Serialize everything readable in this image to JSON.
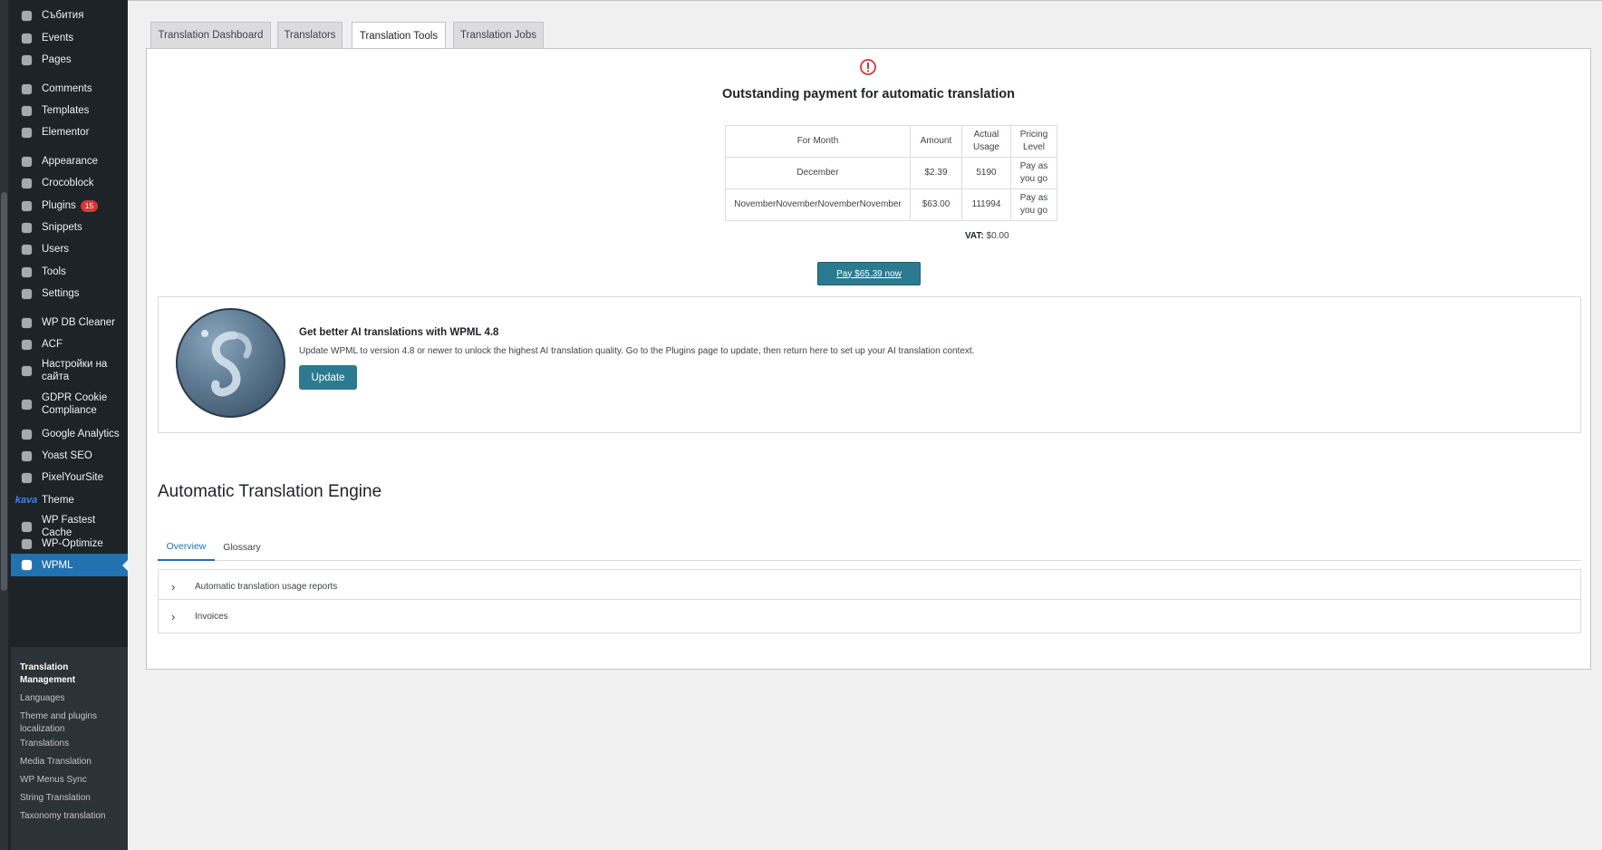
{
  "sidebar": {
    "items": [
      {
        "label": "Събития",
        "icon": "calendar-icon"
      },
      {
        "label": "Events",
        "icon": "events-icon"
      },
      {
        "label": "Pages",
        "icon": "pages-icon"
      },
      {
        "label": "Comments",
        "icon": "comments-icon"
      },
      {
        "label": "Templates",
        "icon": "folder-icon"
      },
      {
        "label": "Elementor",
        "icon": "elementor-icon"
      },
      {
        "label": "Appearance",
        "icon": "brush-icon"
      },
      {
        "label": "Crocoblock",
        "icon": "crocoblock-icon"
      },
      {
        "label": "Plugins",
        "icon": "plugin-icon",
        "badge": "15"
      },
      {
        "label": "Snippets",
        "icon": "scissors-icon"
      },
      {
        "label": "Users",
        "icon": "user-icon"
      },
      {
        "label": "Tools",
        "icon": "wrench-icon"
      },
      {
        "label": "Settings",
        "icon": "settings-icon"
      },
      {
        "label": "WP DB Cleaner",
        "icon": "database-icon"
      },
      {
        "label": "ACF",
        "icon": "acf-icon"
      },
      {
        "label": "Настройки на сайта",
        "icon": "gear-icon"
      },
      {
        "label": "GDPR Cookie Compliance",
        "icon": "checkbox-icon"
      },
      {
        "label": "Google Analytics",
        "icon": "gear-icon"
      },
      {
        "label": "Yoast SEO",
        "icon": "yoast-icon"
      },
      {
        "label": "PixelYourSite",
        "icon": "pixel-icon"
      },
      {
        "label": "Theme",
        "icon": "kava-logo",
        "logo_text": "kava"
      },
      {
        "label": "WP Fastest Cache",
        "icon": "cheetah-icon"
      },
      {
        "label": "WP-Optimize",
        "icon": "optimize-icon"
      },
      {
        "label": "WPML",
        "icon": "wpml-icon"
      }
    ],
    "submenu": [
      "Translation Management",
      "Languages",
      "Theme and plugins localization",
      "Translations",
      "Media Translation",
      "WP Menus Sync",
      "String Translation",
      "Taxonomy translation"
    ]
  },
  "tabs": [
    "Translation Dashboard",
    "Translators",
    "Translation Tools",
    "Translation Jobs"
  ],
  "payment": {
    "title": "Outstanding payment for automatic translation",
    "headers": [
      "For Month",
      "Amount",
      "Actual Usage",
      "Pricing Level"
    ],
    "rows": [
      [
        "December",
        "$2.39",
        "5190",
        "Pay as you go"
      ],
      [
        "NovemberNovemberNovemberNovember",
        "$63.00",
        "111994",
        "Pay as you go"
      ]
    ],
    "vat_label": "VAT:",
    "vat_value": "$0.00",
    "pay_button": "Pay $65.39 now"
  },
  "ai_card": {
    "title": "Get better AI translations with WPML 4.8",
    "description": "Update WPML to version 4.8 or newer to unlock the highest AI translation quality. Go to the Plugins page to update, then return here to set up your AI translation context.",
    "button": "Update"
  },
  "engine": {
    "title": "Automatic Translation Engine",
    "subtabs": [
      "Overview",
      "Glossary"
    ],
    "accordions": [
      "Automatic translation usage reports",
      "Invoices"
    ]
  },
  "colors": {
    "sidebar_bg": "#1d2327",
    "active_menu": "#2271b1",
    "button_teal": "#2b7a8f",
    "warning": "#d63638"
  }
}
